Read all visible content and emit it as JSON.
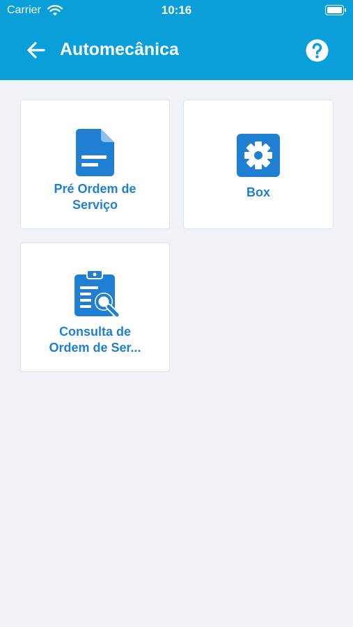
{
  "status_bar": {
    "carrier": "Carrier",
    "time": "10:16"
  },
  "header": {
    "title": "Automecânica",
    "back_icon": "arrow-left-icon",
    "help_icon": "question-circle-icon"
  },
  "colors": {
    "header_bg": "#0a9fd8",
    "page_bg": "#eff3f8",
    "tile_accent": "#1f7fd2"
  },
  "tiles": [
    {
      "label_line1": "Pré Ordem de",
      "label_line2": "Serviço",
      "icon": "document-icon"
    },
    {
      "label_line1": "Box",
      "icon": "gear-icon"
    },
    {
      "label_line1": "Consulta de",
      "label_line2": "Ordem de Ser...",
      "icon": "clipboard-search-icon"
    }
  ]
}
